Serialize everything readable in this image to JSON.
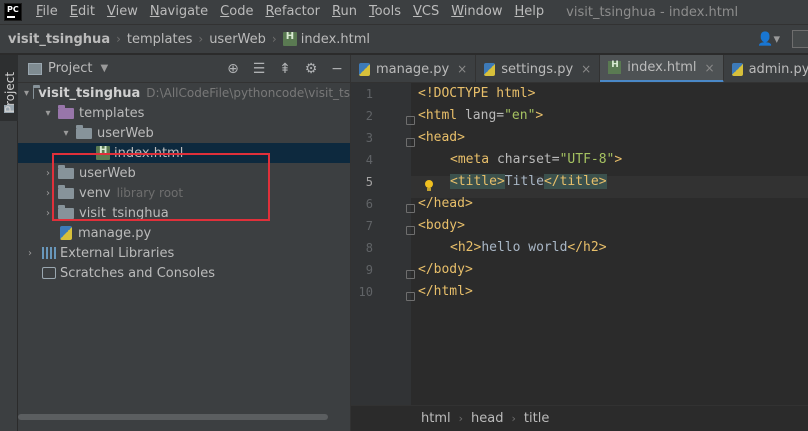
{
  "app": {
    "icon_text": "PC",
    "window_title": "visit_tsinghua - index.html"
  },
  "menu": [
    {
      "u": "F",
      "rest": "ile"
    },
    {
      "u": "E",
      "rest": "dit"
    },
    {
      "u": "V",
      "rest": "iew"
    },
    {
      "u": "N",
      "rest": "avigate"
    },
    {
      "u": "C",
      "rest": "ode"
    },
    {
      "u": "R",
      "rest": "efactor"
    },
    {
      "u": "R",
      "rest": "un"
    },
    {
      "u": "T",
      "rest": "ools"
    },
    {
      "u": "V",
      "rest": "CS"
    },
    {
      "u": "W",
      "rest": "indow"
    },
    {
      "u": "H",
      "rest": "elp"
    }
  ],
  "navbar": {
    "root": "visit_tsinghua",
    "crumb1": "templates",
    "crumb2": "userWeb",
    "crumb3": "index.html",
    "user_glyph": "👤▾"
  },
  "toolwindow": {
    "label": "Project"
  },
  "panel": {
    "title": "Project"
  },
  "tree": {
    "root_name": "visit_tsinghua",
    "root_path": "D:\\AllCodeFile\\pythoncode\\visit_ts",
    "templates": "templates",
    "userweb_sub": "userWeb",
    "index_file": "index.html",
    "userweb": "userWeb",
    "venv": "venv",
    "venv_note": "library root",
    "visit_pkg": "visit_tsinghua",
    "manage": "manage.py",
    "ext_libs": "External Libraries",
    "scratches": "Scratches and Consoles"
  },
  "tabs": [
    {
      "label": "manage.py",
      "type": "py",
      "active": false
    },
    {
      "label": "settings.py",
      "type": "py",
      "active": false
    },
    {
      "label": "index.html",
      "type": "html",
      "active": true
    },
    {
      "label": "admin.py",
      "type": "py",
      "active": false
    }
  ],
  "code": {
    "line_numbers": [
      "1",
      "2",
      "3",
      "4",
      "5",
      "6",
      "7",
      "8",
      "9",
      "10"
    ],
    "l1": "<!DOCTYPE html>",
    "l2_open": "<html ",
    "l2_attr": "lang=",
    "l2_val": "\"en\"",
    "l2_close": ">",
    "l3": "<head>",
    "l4_open": "<meta ",
    "l4_attr": "charset=",
    "l4_val": "\"UTF-8\"",
    "l4_close": ">",
    "l5_open": "<title>",
    "l5_text": "Title",
    "l5_close": "</title>",
    "l6": "</head>",
    "l7": "<body>",
    "l8_open": "<h2>",
    "l8_text": "hello world",
    "l8_close": "</h2>",
    "l9": "</body>",
    "l10": "</html>"
  },
  "breadcrumbs": {
    "b1": "html",
    "b2": "head",
    "b3": "title"
  }
}
